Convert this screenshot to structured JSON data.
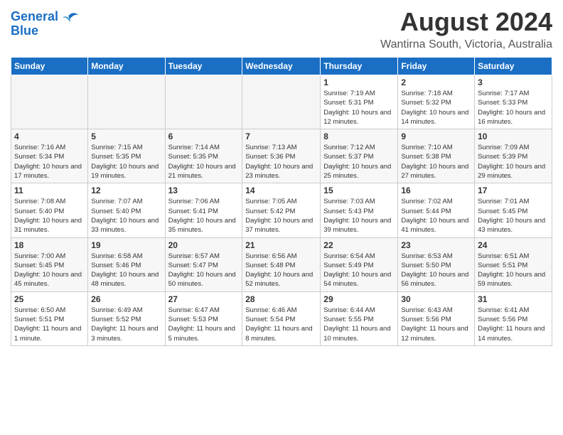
{
  "header": {
    "logo_line1": "General",
    "logo_line2": "Blue",
    "main_title": "August 2024",
    "sub_title": "Wantirna South, Victoria, Australia"
  },
  "days_of_week": [
    "Sunday",
    "Monday",
    "Tuesday",
    "Wednesday",
    "Thursday",
    "Friday",
    "Saturday"
  ],
  "weeks": [
    [
      {
        "day": "",
        "empty": true
      },
      {
        "day": "",
        "empty": true
      },
      {
        "day": "",
        "empty": true
      },
      {
        "day": "",
        "empty": true
      },
      {
        "day": "1",
        "sunrise": "7:19 AM",
        "sunset": "5:31 PM",
        "daylight": "10 hours and 12 minutes."
      },
      {
        "day": "2",
        "sunrise": "7:18 AM",
        "sunset": "5:32 PM",
        "daylight": "10 hours and 14 minutes."
      },
      {
        "day": "3",
        "sunrise": "7:17 AM",
        "sunset": "5:33 PM",
        "daylight": "10 hours and 16 minutes."
      }
    ],
    [
      {
        "day": "4",
        "sunrise": "7:16 AM",
        "sunset": "5:34 PM",
        "daylight": "10 hours and 17 minutes."
      },
      {
        "day": "5",
        "sunrise": "7:15 AM",
        "sunset": "5:35 PM",
        "daylight": "10 hours and 19 minutes."
      },
      {
        "day": "6",
        "sunrise": "7:14 AM",
        "sunset": "5:35 PM",
        "daylight": "10 hours and 21 minutes."
      },
      {
        "day": "7",
        "sunrise": "7:13 AM",
        "sunset": "5:36 PM",
        "daylight": "10 hours and 23 minutes."
      },
      {
        "day": "8",
        "sunrise": "7:12 AM",
        "sunset": "5:37 PM",
        "daylight": "10 hours and 25 minutes."
      },
      {
        "day": "9",
        "sunrise": "7:10 AM",
        "sunset": "5:38 PM",
        "daylight": "10 hours and 27 minutes."
      },
      {
        "day": "10",
        "sunrise": "7:09 AM",
        "sunset": "5:39 PM",
        "daylight": "10 hours and 29 minutes."
      }
    ],
    [
      {
        "day": "11",
        "sunrise": "7:08 AM",
        "sunset": "5:40 PM",
        "daylight": "10 hours and 31 minutes."
      },
      {
        "day": "12",
        "sunrise": "7:07 AM",
        "sunset": "5:40 PM",
        "daylight": "10 hours and 33 minutes."
      },
      {
        "day": "13",
        "sunrise": "7:06 AM",
        "sunset": "5:41 PM",
        "daylight": "10 hours and 35 minutes."
      },
      {
        "day": "14",
        "sunrise": "7:05 AM",
        "sunset": "5:42 PM",
        "daylight": "10 hours and 37 minutes."
      },
      {
        "day": "15",
        "sunrise": "7:03 AM",
        "sunset": "5:43 PM",
        "daylight": "10 hours and 39 minutes."
      },
      {
        "day": "16",
        "sunrise": "7:02 AM",
        "sunset": "5:44 PM",
        "daylight": "10 hours and 41 minutes."
      },
      {
        "day": "17",
        "sunrise": "7:01 AM",
        "sunset": "5:45 PM",
        "daylight": "10 hours and 43 minutes."
      }
    ],
    [
      {
        "day": "18",
        "sunrise": "7:00 AM",
        "sunset": "5:45 PM",
        "daylight": "10 hours and 45 minutes."
      },
      {
        "day": "19",
        "sunrise": "6:58 AM",
        "sunset": "5:46 PM",
        "daylight": "10 hours and 48 minutes."
      },
      {
        "day": "20",
        "sunrise": "6:57 AM",
        "sunset": "5:47 PM",
        "daylight": "10 hours and 50 minutes."
      },
      {
        "day": "21",
        "sunrise": "6:56 AM",
        "sunset": "5:48 PM",
        "daylight": "10 hours and 52 minutes."
      },
      {
        "day": "22",
        "sunrise": "6:54 AM",
        "sunset": "5:49 PM",
        "daylight": "10 hours and 54 minutes."
      },
      {
        "day": "23",
        "sunrise": "6:53 AM",
        "sunset": "5:50 PM",
        "daylight": "10 hours and 56 minutes."
      },
      {
        "day": "24",
        "sunrise": "6:51 AM",
        "sunset": "5:51 PM",
        "daylight": "10 hours and 59 minutes."
      }
    ],
    [
      {
        "day": "25",
        "sunrise": "6:50 AM",
        "sunset": "5:51 PM",
        "daylight": "11 hours and 1 minute."
      },
      {
        "day": "26",
        "sunrise": "6:49 AM",
        "sunset": "5:52 PM",
        "daylight": "11 hours and 3 minutes."
      },
      {
        "day": "27",
        "sunrise": "6:47 AM",
        "sunset": "5:53 PM",
        "daylight": "11 hours and 5 minutes."
      },
      {
        "day": "28",
        "sunrise": "6:46 AM",
        "sunset": "5:54 PM",
        "daylight": "11 hours and 8 minutes."
      },
      {
        "day": "29",
        "sunrise": "6:44 AM",
        "sunset": "5:55 PM",
        "daylight": "11 hours and 10 minutes."
      },
      {
        "day": "30",
        "sunrise": "6:43 AM",
        "sunset": "5:56 PM",
        "daylight": "11 hours and 12 minutes."
      },
      {
        "day": "31",
        "sunrise": "6:41 AM",
        "sunset": "5:56 PM",
        "daylight": "11 hours and 14 minutes."
      }
    ]
  ]
}
